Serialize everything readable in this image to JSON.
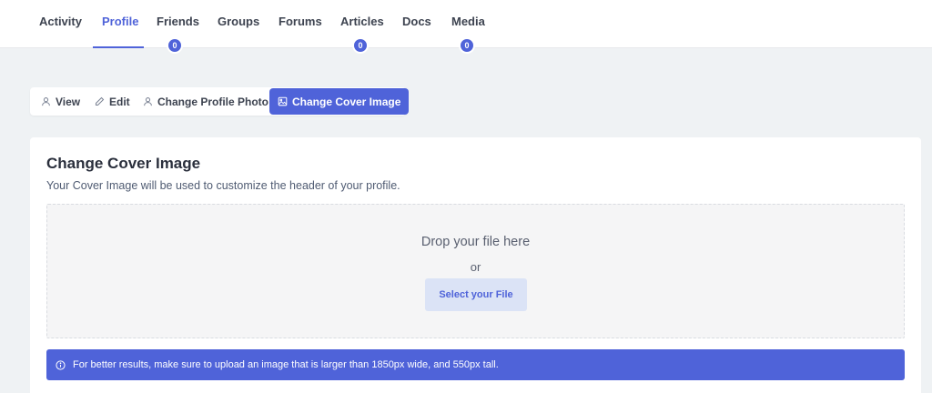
{
  "nav": {
    "tabs": [
      {
        "label": "Activity",
        "badge": null
      },
      {
        "label": "Profile",
        "badge": null,
        "active": true
      },
      {
        "label": "Friends",
        "badge": "0"
      },
      {
        "label": "Groups",
        "badge": null
      },
      {
        "label": "Forums",
        "badge": null
      },
      {
        "label": "Articles",
        "badge": "0"
      },
      {
        "label": "Docs",
        "badge": null
      },
      {
        "label": "Media",
        "badge": "0"
      }
    ]
  },
  "subnav": {
    "items": [
      {
        "label": "View",
        "icon": "user-icon"
      },
      {
        "label": "Edit",
        "icon": "pencil-icon"
      },
      {
        "label": "Change Profile Photo",
        "icon": "user-icon"
      },
      {
        "label": "Change Cover Image",
        "icon": "image-icon",
        "active": true
      }
    ]
  },
  "card": {
    "title": "Change Cover Image",
    "description": "Your Cover Image will be used to customize the header of your profile.",
    "dropzone": {
      "drop_text": "Drop your file here",
      "or_text": "or",
      "select_label": "Select your File"
    },
    "notice": "For better results, make sure to upload an image that is larger than 1850px wide, and 550px tall."
  },
  "colors": {
    "accent": "#4f63d9",
    "background": "#eff2f4",
    "select_button_bg": "#dbe3f6"
  }
}
